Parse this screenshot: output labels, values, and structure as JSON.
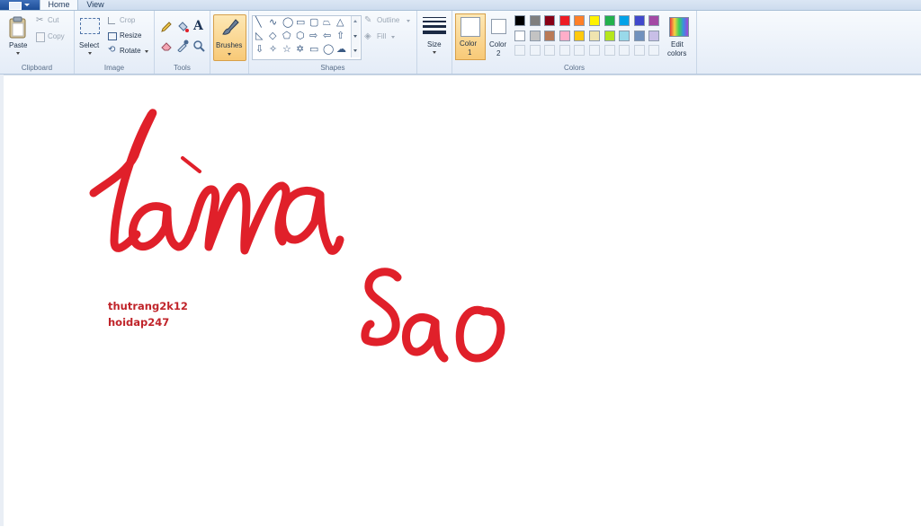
{
  "tabs": {
    "home": "Home",
    "view": "View"
  },
  "clipboard": {
    "paste": "Paste",
    "cut": "Cut",
    "copy": "Copy",
    "label": "Clipboard"
  },
  "image": {
    "select": "Select",
    "crop": "Crop",
    "resize": "Resize",
    "rotate": "Rotate",
    "label": "Image"
  },
  "tools": {
    "label": "Tools",
    "text_tool_glyph": "A"
  },
  "brushes": {
    "label": "Brushes"
  },
  "shapes": {
    "outline": "Outline",
    "fill": "Fill",
    "label": "Shapes"
  },
  "size": {
    "label": "Size"
  },
  "colors": {
    "color1": "Color",
    "color1_num": "1",
    "color2": "Color",
    "color2_num": "2",
    "edit": "Edit",
    "edit2": "colors",
    "label": "Colors",
    "palette_row1": [
      "#000000",
      "#7f7f7f",
      "#880015",
      "#ed1c24",
      "#ff7f27",
      "#fff200",
      "#22b14c",
      "#00a2e8",
      "#3f48cc",
      "#a349a4"
    ],
    "palette_row2": [
      "#ffffff",
      "#c3c3c3",
      "#b97a57",
      "#ffaec9",
      "#ffc90e",
      "#efe4b0",
      "#b5e61d",
      "#99d9ea",
      "#7092be",
      "#c8bfe7"
    ]
  },
  "canvas": {
    "note_line1": "thutrang2k12",
    "note_line2": "hoidap247",
    "ink_color": "#e0202a"
  }
}
